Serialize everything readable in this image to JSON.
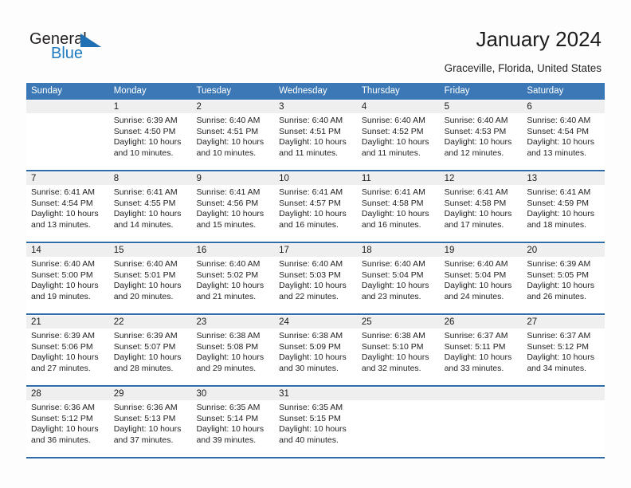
{
  "brand": {
    "name_part1": "General",
    "name_part2": "Blue",
    "triangle_color": "#1f6fb5",
    "blue_color": "#1f7bc1"
  },
  "header": {
    "title": "January 2024",
    "subtitle": "Graceville, Florida, United States"
  },
  "colors": {
    "header_blue": "#3b78b5",
    "week_divider": "#2f6ca8",
    "daynum_band": "#efefef"
  },
  "calendar": {
    "weekday_headers": [
      "Sunday",
      "Monday",
      "Tuesday",
      "Wednesday",
      "Thursday",
      "Friday",
      "Saturday"
    ],
    "weeks": [
      [
        {
          "day": "",
          "sunrise": "",
          "sunset": "",
          "daylight_line1": "",
          "daylight_line2": ""
        },
        {
          "day": "1",
          "sunrise": "Sunrise: 6:39 AM",
          "sunset": "Sunset: 4:50 PM",
          "daylight_line1": "Daylight: 10 hours",
          "daylight_line2": "and 10 minutes."
        },
        {
          "day": "2",
          "sunrise": "Sunrise: 6:40 AM",
          "sunset": "Sunset: 4:51 PM",
          "daylight_line1": "Daylight: 10 hours",
          "daylight_line2": "and 10 minutes."
        },
        {
          "day": "3",
          "sunrise": "Sunrise: 6:40 AM",
          "sunset": "Sunset: 4:51 PM",
          "daylight_line1": "Daylight: 10 hours",
          "daylight_line2": "and 11 minutes."
        },
        {
          "day": "4",
          "sunrise": "Sunrise: 6:40 AM",
          "sunset": "Sunset: 4:52 PM",
          "daylight_line1": "Daylight: 10 hours",
          "daylight_line2": "and 11 minutes."
        },
        {
          "day": "5",
          "sunrise": "Sunrise: 6:40 AM",
          "sunset": "Sunset: 4:53 PM",
          "daylight_line1": "Daylight: 10 hours",
          "daylight_line2": "and 12 minutes."
        },
        {
          "day": "6",
          "sunrise": "Sunrise: 6:40 AM",
          "sunset": "Sunset: 4:54 PM",
          "daylight_line1": "Daylight: 10 hours",
          "daylight_line2": "and 13 minutes."
        }
      ],
      [
        {
          "day": "7",
          "sunrise": "Sunrise: 6:41 AM",
          "sunset": "Sunset: 4:54 PM",
          "daylight_line1": "Daylight: 10 hours",
          "daylight_line2": "and 13 minutes."
        },
        {
          "day": "8",
          "sunrise": "Sunrise: 6:41 AM",
          "sunset": "Sunset: 4:55 PM",
          "daylight_line1": "Daylight: 10 hours",
          "daylight_line2": "and 14 minutes."
        },
        {
          "day": "9",
          "sunrise": "Sunrise: 6:41 AM",
          "sunset": "Sunset: 4:56 PM",
          "daylight_line1": "Daylight: 10 hours",
          "daylight_line2": "and 15 minutes."
        },
        {
          "day": "10",
          "sunrise": "Sunrise: 6:41 AM",
          "sunset": "Sunset: 4:57 PM",
          "daylight_line1": "Daylight: 10 hours",
          "daylight_line2": "and 16 minutes."
        },
        {
          "day": "11",
          "sunrise": "Sunrise: 6:41 AM",
          "sunset": "Sunset: 4:58 PM",
          "daylight_line1": "Daylight: 10 hours",
          "daylight_line2": "and 16 minutes."
        },
        {
          "day": "12",
          "sunrise": "Sunrise: 6:41 AM",
          "sunset": "Sunset: 4:58 PM",
          "daylight_line1": "Daylight: 10 hours",
          "daylight_line2": "and 17 minutes."
        },
        {
          "day": "13",
          "sunrise": "Sunrise: 6:41 AM",
          "sunset": "Sunset: 4:59 PM",
          "daylight_line1": "Daylight: 10 hours",
          "daylight_line2": "and 18 minutes."
        }
      ],
      [
        {
          "day": "14",
          "sunrise": "Sunrise: 6:40 AM",
          "sunset": "Sunset: 5:00 PM",
          "daylight_line1": "Daylight: 10 hours",
          "daylight_line2": "and 19 minutes."
        },
        {
          "day": "15",
          "sunrise": "Sunrise: 6:40 AM",
          "sunset": "Sunset: 5:01 PM",
          "daylight_line1": "Daylight: 10 hours",
          "daylight_line2": "and 20 minutes."
        },
        {
          "day": "16",
          "sunrise": "Sunrise: 6:40 AM",
          "sunset": "Sunset: 5:02 PM",
          "daylight_line1": "Daylight: 10 hours",
          "daylight_line2": "and 21 minutes."
        },
        {
          "day": "17",
          "sunrise": "Sunrise: 6:40 AM",
          "sunset": "Sunset: 5:03 PM",
          "daylight_line1": "Daylight: 10 hours",
          "daylight_line2": "and 22 minutes."
        },
        {
          "day": "18",
          "sunrise": "Sunrise: 6:40 AM",
          "sunset": "Sunset: 5:04 PM",
          "daylight_line1": "Daylight: 10 hours",
          "daylight_line2": "and 23 minutes."
        },
        {
          "day": "19",
          "sunrise": "Sunrise: 6:40 AM",
          "sunset": "Sunset: 5:04 PM",
          "daylight_line1": "Daylight: 10 hours",
          "daylight_line2": "and 24 minutes."
        },
        {
          "day": "20",
          "sunrise": "Sunrise: 6:39 AM",
          "sunset": "Sunset: 5:05 PM",
          "daylight_line1": "Daylight: 10 hours",
          "daylight_line2": "and 26 minutes."
        }
      ],
      [
        {
          "day": "21",
          "sunrise": "Sunrise: 6:39 AM",
          "sunset": "Sunset: 5:06 PM",
          "daylight_line1": "Daylight: 10 hours",
          "daylight_line2": "and 27 minutes."
        },
        {
          "day": "22",
          "sunrise": "Sunrise: 6:39 AM",
          "sunset": "Sunset: 5:07 PM",
          "daylight_line1": "Daylight: 10 hours",
          "daylight_line2": "and 28 minutes."
        },
        {
          "day": "23",
          "sunrise": "Sunrise: 6:38 AM",
          "sunset": "Sunset: 5:08 PM",
          "daylight_line1": "Daylight: 10 hours",
          "daylight_line2": "and 29 minutes."
        },
        {
          "day": "24",
          "sunrise": "Sunrise: 6:38 AM",
          "sunset": "Sunset: 5:09 PM",
          "daylight_line1": "Daylight: 10 hours",
          "daylight_line2": "and 30 minutes."
        },
        {
          "day": "25",
          "sunrise": "Sunrise: 6:38 AM",
          "sunset": "Sunset: 5:10 PM",
          "daylight_line1": "Daylight: 10 hours",
          "daylight_line2": "and 32 minutes."
        },
        {
          "day": "26",
          "sunrise": "Sunrise: 6:37 AM",
          "sunset": "Sunset: 5:11 PM",
          "daylight_line1": "Daylight: 10 hours",
          "daylight_line2": "and 33 minutes."
        },
        {
          "day": "27",
          "sunrise": "Sunrise: 6:37 AM",
          "sunset": "Sunset: 5:12 PM",
          "daylight_line1": "Daylight: 10 hours",
          "daylight_line2": "and 34 minutes."
        }
      ],
      [
        {
          "day": "28",
          "sunrise": "Sunrise: 6:36 AM",
          "sunset": "Sunset: 5:12 PM",
          "daylight_line1": "Daylight: 10 hours",
          "daylight_line2": "and 36 minutes."
        },
        {
          "day": "29",
          "sunrise": "Sunrise: 6:36 AM",
          "sunset": "Sunset: 5:13 PM",
          "daylight_line1": "Daylight: 10 hours",
          "daylight_line2": "and 37 minutes."
        },
        {
          "day": "30",
          "sunrise": "Sunrise: 6:35 AM",
          "sunset": "Sunset: 5:14 PM",
          "daylight_line1": "Daylight: 10 hours",
          "daylight_line2": "and 39 minutes."
        },
        {
          "day": "31",
          "sunrise": "Sunrise: 6:35 AM",
          "sunset": "Sunset: 5:15 PM",
          "daylight_line1": "Daylight: 10 hours",
          "daylight_line2": "and 40 minutes."
        },
        {
          "day": "",
          "sunrise": "",
          "sunset": "",
          "daylight_line1": "",
          "daylight_line2": ""
        },
        {
          "day": "",
          "sunrise": "",
          "sunset": "",
          "daylight_line1": "",
          "daylight_line2": ""
        },
        {
          "day": "",
          "sunrise": "",
          "sunset": "",
          "daylight_line1": "",
          "daylight_line2": ""
        }
      ]
    ]
  }
}
